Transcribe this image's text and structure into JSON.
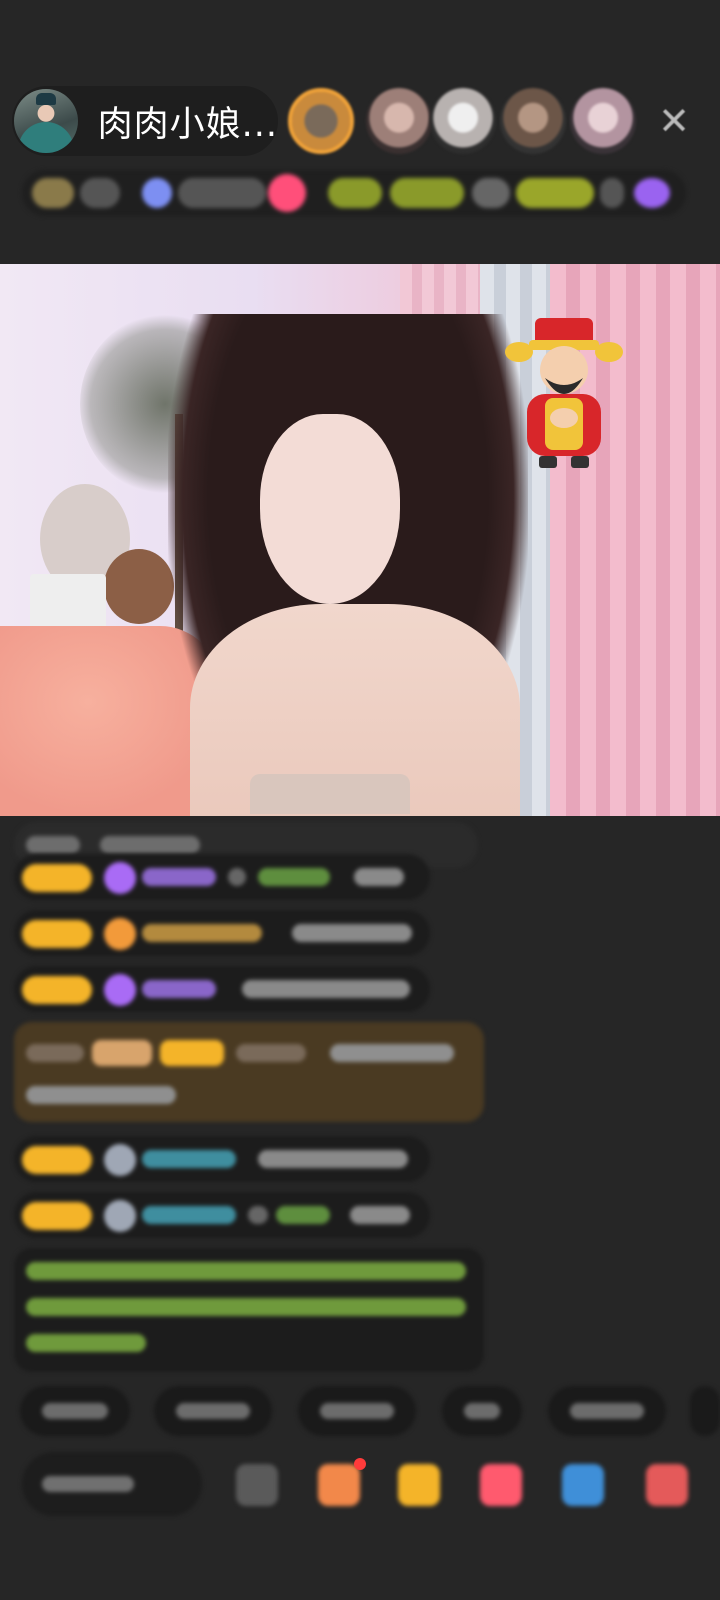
{
  "header": {
    "host_name": "肉肉小娘...",
    "close_icon": "close-icon"
  },
  "viewers": [
    {
      "color": "#c98a3c",
      "ring": "#f2a43a"
    },
    {
      "color": "#c7a49a",
      "ring": "#2a2a2a"
    },
    {
      "color": "#d8d3d0",
      "ring": "#2a2a2a"
    },
    {
      "color": "#8d7566",
      "ring": "#2a2a2a"
    },
    {
      "color": "#c9aeb7",
      "ring": "#2a2a2a"
    }
  ],
  "colors": {
    "gold_badge": "#f4b429",
    "purple_gem": "#a96bf5",
    "orange_gem": "#f29a3a",
    "cyan_name": "#4fb7c8",
    "green_text": "#8bc24a",
    "pink": "#ff4f7a"
  },
  "icons": {
    "tagbar": [
      "level-badge-icon",
      "fans-icon",
      "live-icon",
      "gift-icon"
    ],
    "bottom": [
      "emoji-icon",
      "gift-box-icon",
      "treasure-icon",
      "red-packet-icon",
      "game-icon",
      "more-icon"
    ]
  }
}
